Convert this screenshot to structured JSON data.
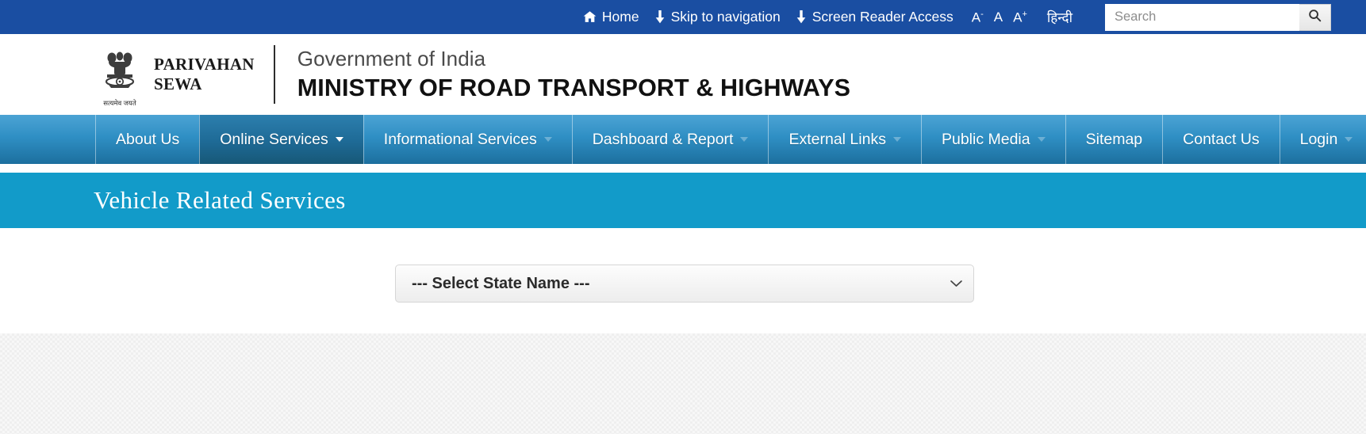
{
  "topbar": {
    "links": [
      {
        "label": "Home",
        "icon": "home-icon"
      },
      {
        "label": "Skip to navigation",
        "icon": "down-arrow-icon"
      },
      {
        "label": "Screen Reader Access",
        "icon": "down-arrow-icon"
      }
    ],
    "font_decrease": "A",
    "font_decrease_sup": "-",
    "font_normal": "A",
    "font_increase": "A",
    "font_increase_sup": "+",
    "language": "हिन्दी",
    "search_placeholder": "Search",
    "search_value": "",
    "search_icon": "search-icon",
    "bg_color": "#1a4ea2"
  },
  "header": {
    "emblem_caption": "सत्यमेव जयते",
    "brand_line1": "PARIVAHAN",
    "brand_line2": "SEWA",
    "government": "Government of India",
    "ministry": "MINISTRY OF ROAD TRANSPORT & HIGHWAYS"
  },
  "nav": {
    "items": [
      {
        "label": "About Us",
        "caret": false,
        "active": false
      },
      {
        "label": "Online Services",
        "caret": true,
        "caret_bright": true,
        "active": true
      },
      {
        "label": "Informational Services",
        "caret": true,
        "caret_bright": false,
        "active": false
      },
      {
        "label": "Dashboard & Report",
        "caret": true,
        "caret_bright": false,
        "active": false
      },
      {
        "label": "External Links",
        "caret": true,
        "caret_bright": false,
        "active": false
      },
      {
        "label": "Public Media",
        "caret": true,
        "caret_bright": false,
        "active": false
      },
      {
        "label": "Sitemap",
        "caret": false,
        "active": false
      },
      {
        "label": "Contact Us",
        "caret": false,
        "active": false
      },
      {
        "label": "Login",
        "caret": true,
        "caret_bright": false,
        "active": false
      }
    ],
    "accent_color": "#2f8fc4"
  },
  "page": {
    "title": "Vehicle Related Services",
    "title_bg_color": "#129bc9"
  },
  "form": {
    "state_select": {
      "selected": "--- Select State Name ---",
      "options": [
        "--- Select State Name ---"
      ],
      "arrow_icon": "chevron-down-icon"
    }
  }
}
